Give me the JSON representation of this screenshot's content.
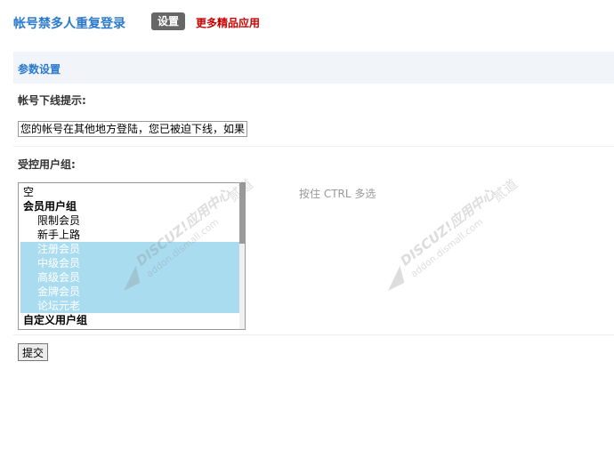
{
  "header": {
    "title": "帐号禁多人重复登录",
    "settings_tab": "设置",
    "more_link": "更多精品应用"
  },
  "section": {
    "title": "参数设置"
  },
  "form": {
    "offline_label": "帐号下线提示:",
    "offline_value": "您的帐号在其他地方登陆，您已被迫下线，如果",
    "groups_label": "受控用户组:",
    "groups": [
      {
        "label": "空",
        "kind": "plain",
        "selected": false
      },
      {
        "label": "会员用户组",
        "kind": "group",
        "selected": false
      },
      {
        "label": "限制会员",
        "kind": "child",
        "selected": false
      },
      {
        "label": "新手上路",
        "kind": "child",
        "selected": false
      },
      {
        "label": "注册会员",
        "kind": "child",
        "selected": true
      },
      {
        "label": "中级会员",
        "kind": "child",
        "selected": true
      },
      {
        "label": "高级会员",
        "kind": "child",
        "selected": true
      },
      {
        "label": "金牌会员",
        "kind": "child",
        "selected": true
      },
      {
        "label": "论坛元老",
        "kind": "child",
        "selected": true
      },
      {
        "label": "自定义用户组",
        "kind": "group",
        "selected": false
      }
    ],
    "groups_hint": "按住 CTRL 多选",
    "submit_label": "提交"
  },
  "watermark": {
    "brand": "DISCUZ!应用中心",
    "domain": "addon.dismall.com",
    "partner": "贰道"
  },
  "colors": {
    "title": "#2b7acd",
    "more_link": "#cc0000",
    "settings_tab_bg": "#666666",
    "section_bg": "#f1f5fa",
    "selected_bg": "#aadcf0"
  }
}
